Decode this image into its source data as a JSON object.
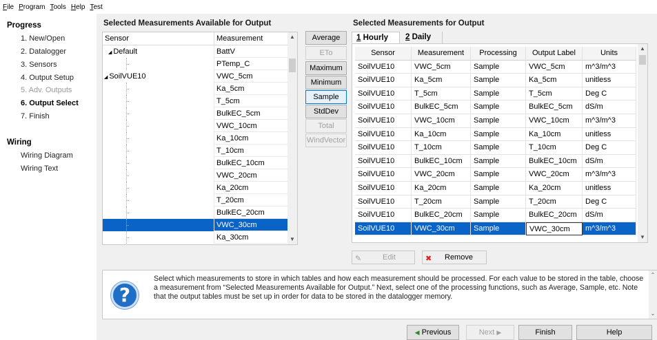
{
  "menu": [
    "File",
    "Program",
    "Tools",
    "Help",
    "Test"
  ],
  "progress": {
    "title": "Progress",
    "steps": [
      "1. New/Open",
      "2. Datalogger",
      "3. Sensors",
      "4. Output Setup",
      "5. Adv. Outputs",
      "6. Output Select",
      "7. Finish"
    ]
  },
  "wiring": {
    "title": "Wiring",
    "items": [
      "Wiring Diagram",
      "Wiring Text"
    ]
  },
  "available": {
    "title": "Selected Measurements Available for Output",
    "headers": [
      "Sensor",
      "Measurement"
    ],
    "rows": [
      {
        "sensor": "Default",
        "measurement": "BattV"
      },
      {
        "sensor": "",
        "measurement": "PTemp_C"
      },
      {
        "sensor": "SoilVUE10",
        "measurement": "VWC_5cm"
      },
      {
        "sensor": "",
        "measurement": "Ka_5cm"
      },
      {
        "sensor": "",
        "measurement": "T_5cm"
      },
      {
        "sensor": "",
        "measurement": "BulkEC_5cm"
      },
      {
        "sensor": "",
        "measurement": "VWC_10cm"
      },
      {
        "sensor": "",
        "measurement": "Ka_10cm"
      },
      {
        "sensor": "",
        "measurement": "T_10cm"
      },
      {
        "sensor": "",
        "measurement": "BulkEC_10cm"
      },
      {
        "sensor": "",
        "measurement": "VWC_20cm"
      },
      {
        "sensor": "",
        "measurement": "Ka_20cm"
      },
      {
        "sensor": "",
        "measurement": "T_20cm"
      },
      {
        "sensor": "",
        "measurement": "BulkEC_20cm"
      },
      {
        "sensor": "",
        "measurement": "VWC_30cm"
      },
      {
        "sensor": "",
        "measurement": "Ka_30cm"
      }
    ]
  },
  "processing": [
    "Average",
    "ETo",
    "Maximum",
    "Minimum",
    "Sample",
    "StdDev",
    "Total",
    "WindVector"
  ],
  "output": {
    "title": "Selected Measurements for Output",
    "tabs": [
      {
        "num": "1",
        "label": "Hourly"
      },
      {
        "num": "2",
        "label": "Daily"
      }
    ],
    "headers": [
      "Sensor",
      "Measurement",
      "Processing",
      "Output Label",
      "Units"
    ],
    "rows": [
      [
        "SoilVUE10",
        "VWC_5cm",
        "Sample",
        "VWC_5cm",
        "m^3/m^3"
      ],
      [
        "SoilVUE10",
        "Ka_5cm",
        "Sample",
        "Ka_5cm",
        "unitless"
      ],
      [
        "SoilVUE10",
        "T_5cm",
        "Sample",
        "T_5cm",
        "Deg C"
      ],
      [
        "SoilVUE10",
        "BulkEC_5cm",
        "Sample",
        "BulkEC_5cm",
        "dS/m"
      ],
      [
        "SoilVUE10",
        "VWC_10cm",
        "Sample",
        "VWC_10cm",
        "m^3/m^3"
      ],
      [
        "SoilVUE10",
        "Ka_10cm",
        "Sample",
        "Ka_10cm",
        "unitless"
      ],
      [
        "SoilVUE10",
        "T_10cm",
        "Sample",
        "T_10cm",
        "Deg C"
      ],
      [
        "SoilVUE10",
        "BulkEC_10cm",
        "Sample",
        "BulkEC_10cm",
        "dS/m"
      ],
      [
        "SoilVUE10",
        "VWC_20cm",
        "Sample",
        "VWC_20cm",
        "m^3/m^3"
      ],
      [
        "SoilVUE10",
        "Ka_20cm",
        "Sample",
        "Ka_20cm",
        "unitless"
      ],
      [
        "SoilVUE10",
        "T_20cm",
        "Sample",
        "T_20cm",
        "Deg C"
      ],
      [
        "SoilVUE10",
        "BulkEC_20cm",
        "Sample",
        "BulkEC_20cm",
        "dS/m"
      ],
      [
        "SoilVUE10",
        "VWC_30cm",
        "Sample",
        "VWC_30cm",
        "m^3/m^3"
      ]
    ],
    "edit_label": "Edit",
    "remove_label": "Remove"
  },
  "help_text": "Select which measurements to store in which tables and how each measurement should be processed. For each value to be stored in the table, choose a measurement from “Selected Measurements Available for Output.”  Next, select one of the processing functions, such as Average, Sample, etc. Note that the output tables must be set up in order for data to be stored in the datalogger memory.",
  "footer": {
    "previous": "Previous",
    "next": "Next",
    "finish": "Finish",
    "help": "Help"
  },
  "colors": {
    "selection": "#0a64c8",
    "help_icon": "#1f6fc6"
  }
}
